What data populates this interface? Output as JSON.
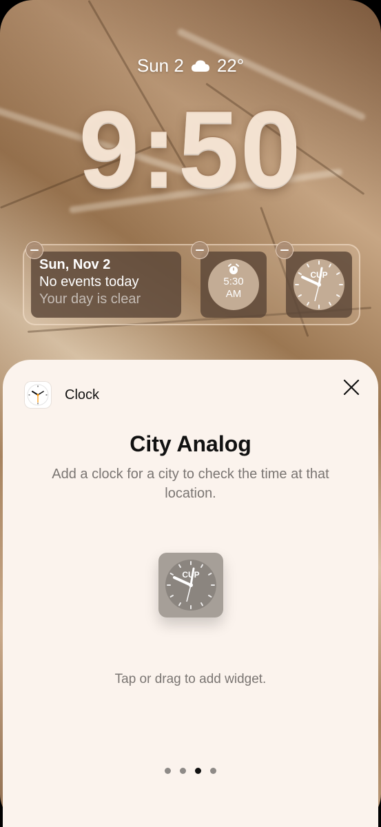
{
  "status": {
    "date": "Sun 2",
    "weather_icon": "cloud-icon",
    "temperature": "22°"
  },
  "lock_time": "9:50",
  "widgets": {
    "calendar": {
      "date": "Sun, Nov 2",
      "events": "No events today",
      "note": "Your day is clear"
    },
    "alarm": {
      "icon": "alarm-clock-icon",
      "time": "5:30",
      "ampm": "AM"
    },
    "city_clock": {
      "city": "CUP"
    }
  },
  "sheet": {
    "app_name": "Clock",
    "title": "City Analog",
    "description": "Add a clock for a city to check the time at that location.",
    "preview_city": "CUP",
    "hint": "Tap or drag to add widget.",
    "pages": 4,
    "active_page": 3
  },
  "colors": {
    "sheet_bg": "#fbf3ed",
    "widget_bg": "#5a4637",
    "accent": "#ff9500"
  }
}
